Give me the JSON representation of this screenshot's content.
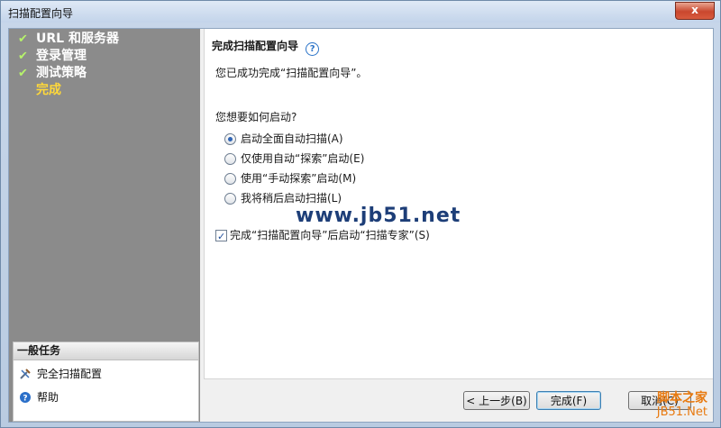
{
  "window": {
    "title": "扫描配置向导",
    "close_label": "x"
  },
  "sidebar": {
    "steps": [
      {
        "label": "URL 和服务器",
        "done": true
      },
      {
        "label": "登录管理",
        "done": true
      },
      {
        "label": "测试策略",
        "done": true
      },
      {
        "label": "完成",
        "done": false
      }
    ],
    "tasks_title": "一般任务",
    "tasks": [
      {
        "label": "完全扫描配置",
        "icon": "tools-icon"
      },
      {
        "label": "帮助",
        "icon": "help-icon"
      }
    ]
  },
  "main": {
    "heading": "完成扫描配置向导",
    "help_glyph": "?",
    "intro": "您已成功完成“扫描配置向导”。",
    "question": "您想要如何启动?",
    "options": [
      {
        "label": "启动全面自动扫描(A)",
        "selected": true
      },
      {
        "label": "仅使用自动“探索”启动(E)",
        "selected": false
      },
      {
        "label": "使用“手动探索”启动(M)",
        "selected": false
      },
      {
        "label": "我将稍后启动扫描(L)",
        "selected": false
      }
    ],
    "checkbox_label": "完成“扫描配置向导”后启动“扫描专家”(S)",
    "checkbox_checked": true
  },
  "watermark": "www.jb51.net",
  "buttons": {
    "prev": "< 上一步(B)",
    "finish": "完成(F)",
    "cancel": "取消(C)"
  },
  "brand": {
    "line1": "脚本之家",
    "line2": "JB51.Net"
  }
}
